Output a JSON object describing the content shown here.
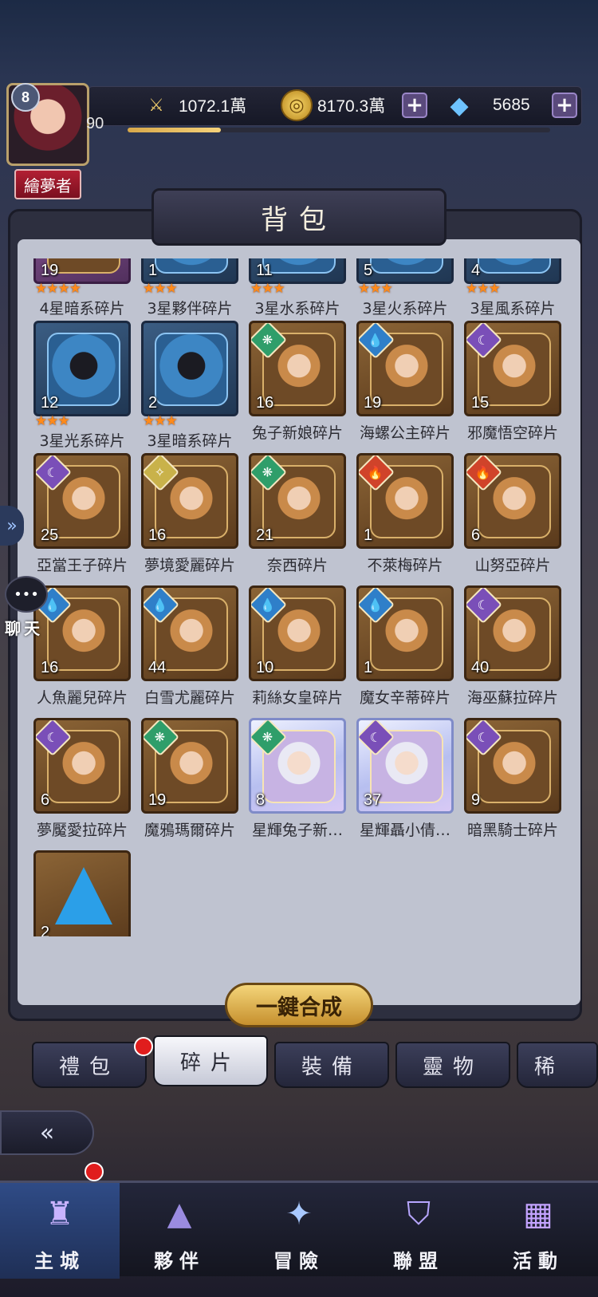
{
  "player": {
    "level": "8",
    "vip": "90",
    "exp_fraction": 0.22,
    "title": "繪夢者"
  },
  "resources": {
    "power": "1072.1萬",
    "gold": "8170.3萬",
    "diamond": "5685"
  },
  "panel": {
    "title": "背包"
  },
  "items": [
    {
      "name": "4星暗系碎片",
      "qty": "19",
      "stars": "★★★★",
      "style": "purple",
      "icon": "dark-element-icon"
    },
    {
      "name": "3星夥伴碎片",
      "qty": "1",
      "stars": "★★★",
      "style": "blue",
      "icon": "hooded-figure-icon"
    },
    {
      "name": "3星水系碎片",
      "qty": "11",
      "stars": "★★★",
      "style": "blue",
      "icon": "water-element-icon"
    },
    {
      "name": "3星火系碎片",
      "qty": "5",
      "stars": "★★★",
      "style": "blue",
      "icon": "fire-element-icon"
    },
    {
      "name": "3星風系碎片",
      "qty": "4",
      "stars": "★★★",
      "style": "blue",
      "icon": "wind-element-icon"
    },
    {
      "name": "3星光系碎片",
      "qty": "12",
      "stars": "★★★",
      "style": "blue",
      "icon": "light-element-icon"
    },
    {
      "name": "3星暗系碎片",
      "qty": "2",
      "stars": "★★★",
      "style": "blue",
      "icon": "dark-element-icon"
    },
    {
      "name": "兔子新娘碎片",
      "qty": "16",
      "stars": "",
      "style": "gold",
      "icon": "wind-element-icon"
    },
    {
      "name": "海螺公主碎片",
      "qty": "19",
      "stars": "",
      "style": "gold",
      "icon": "water-element-icon"
    },
    {
      "name": "邪魔悟空碎片",
      "qty": "15",
      "stars": "",
      "style": "gold",
      "icon": "dark-element-icon"
    },
    {
      "name": "亞當王子碎片",
      "qty": "25",
      "stars": "",
      "style": "gold",
      "icon": "dark-element-icon"
    },
    {
      "name": "夢境愛麗碎片",
      "qty": "16",
      "stars": "",
      "style": "gold",
      "icon": "light-element-icon"
    },
    {
      "name": "奈西碎片",
      "qty": "21",
      "stars": "",
      "style": "gold",
      "icon": "wind-element-icon"
    },
    {
      "name": "不萊梅碎片",
      "qty": "1",
      "stars": "",
      "style": "gold",
      "icon": "fire-element-icon"
    },
    {
      "name": "山努亞碎片",
      "qty": "6",
      "stars": "",
      "style": "gold",
      "icon": "fire-element-icon"
    },
    {
      "name": "人魚麗兒碎片",
      "qty": "16",
      "stars": "",
      "style": "gold",
      "icon": "water-element-icon"
    },
    {
      "name": "白雪尤麗碎片",
      "qty": "44",
      "stars": "",
      "style": "gold",
      "icon": "water-element-icon"
    },
    {
      "name": "莉絲女皇碎片",
      "qty": "10",
      "stars": "",
      "style": "gold",
      "icon": "water-element-icon"
    },
    {
      "name": "魔女辛蒂碎片",
      "qty": "1",
      "stars": "",
      "style": "gold",
      "icon": "water-element-icon"
    },
    {
      "name": "海巫蘇拉碎片",
      "qty": "40",
      "stars": "",
      "style": "gold",
      "icon": "dark-element-icon"
    },
    {
      "name": "夢魘愛拉碎片",
      "qty": "6",
      "stars": "",
      "style": "gold",
      "icon": "dark-element-icon"
    },
    {
      "name": "魔鴉瑪爾碎片",
      "qty": "19",
      "stars": "",
      "style": "gold",
      "icon": "wind-element-icon"
    },
    {
      "name": "星輝兔子新…",
      "qty": "8",
      "stars": "",
      "style": "shiny",
      "icon": "wind-element-icon"
    },
    {
      "name": "星輝聶小倩…",
      "qty": "37",
      "stars": "",
      "style": "shiny",
      "icon": "dark-element-icon"
    },
    {
      "name": "暗黑騎士碎片",
      "qty": "9",
      "stars": "",
      "style": "gold",
      "icon": "dark-element-icon"
    },
    {
      "name": "",
      "qty": "2",
      "stars": "",
      "style": "gold",
      "icon": "blue-crystal-icon"
    }
  ],
  "merge_button": "一鍵合成",
  "tabs": [
    "禮包",
    "碎片",
    "裝備",
    "靈物",
    "稀"
  ],
  "chat": {
    "label": "聊天",
    "icon": "speech-bubble-icon"
  },
  "bottom_nav": [
    "主城",
    "夥伴",
    "冒險",
    "聯盟",
    "活動"
  ],
  "colors": {
    "star": "#ff8a1a",
    "badge_red": "#e01d1d",
    "merge_gold": "#f4d57a"
  }
}
